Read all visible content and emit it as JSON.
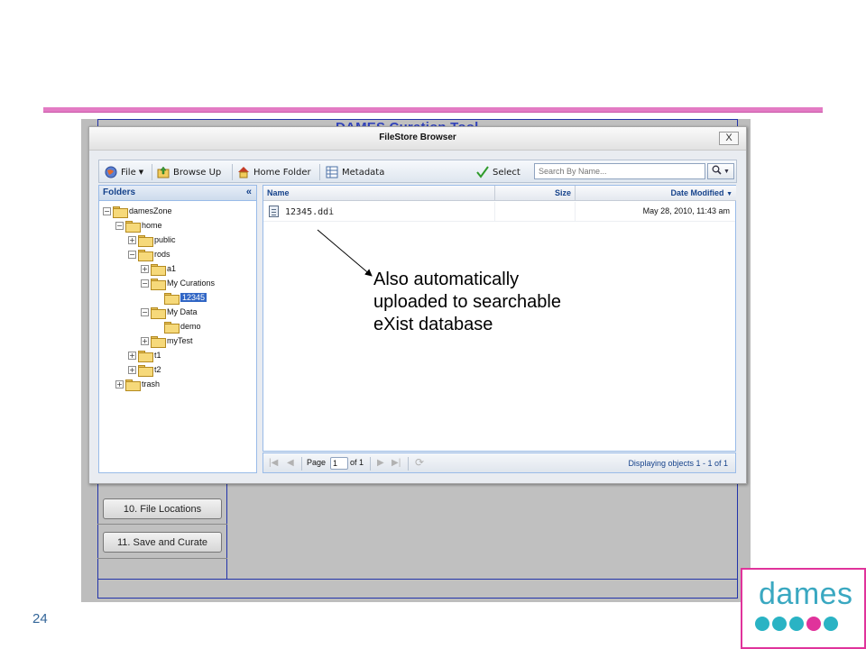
{
  "slide": {
    "number": "24"
  },
  "background_app": {
    "title_partial": "DAMES Curation Tool",
    "steps": [
      "10. File Locations",
      "11. Save and Curate"
    ]
  },
  "dialog": {
    "title": "FileStore Browser",
    "close_label": "X",
    "toolbar": {
      "file": "File",
      "browse_up": "Browse Up",
      "home_folder": "Home Folder",
      "metadata": "Metadata",
      "select": "Select",
      "search_placeholder": "Search By Name..."
    },
    "folders": {
      "header": "Folders",
      "collapse": "«",
      "tree": [
        {
          "label": "damesZone",
          "toggle": "−"
        },
        {
          "label": "home",
          "toggle": "−"
        },
        {
          "label": "public",
          "toggle": "+"
        },
        {
          "label": "rods",
          "toggle": "−"
        },
        {
          "label": "a1",
          "toggle": "+"
        },
        {
          "label": "My Curations",
          "toggle": "−"
        },
        {
          "label": "12345",
          "toggle": "",
          "selected": true
        },
        {
          "label": "My Data",
          "toggle": "−"
        },
        {
          "label": "demo",
          "toggle": ""
        },
        {
          "label": "myTest",
          "toggle": "+"
        },
        {
          "label": "t1",
          "toggle": "+"
        },
        {
          "label": "t2",
          "toggle": "+"
        },
        {
          "label": "trash",
          "toggle": "+"
        }
      ]
    },
    "files": {
      "columns": {
        "name": "Name",
        "size": "Size",
        "date": "Date Modified"
      },
      "rows": [
        {
          "name": "12345.ddi",
          "size": "",
          "date": "May 28, 2010, 11:43 am"
        }
      ]
    },
    "pager": {
      "page_label": "Page",
      "page_value": "1",
      "of_label": "of 1",
      "info": "Displaying objects 1 - 1 of 1"
    }
  },
  "callout": {
    "line1": "Also automatically",
    "line2": "uploaded to searchable",
    "line3": "eXist database"
  },
  "logo": {
    "text": "dames",
    "colors": {
      "text": "#3aa8c1",
      "border": "#e0339b",
      "dot_teal": "#2ab3c4",
      "dot_pink": "#e0339b"
    }
  }
}
